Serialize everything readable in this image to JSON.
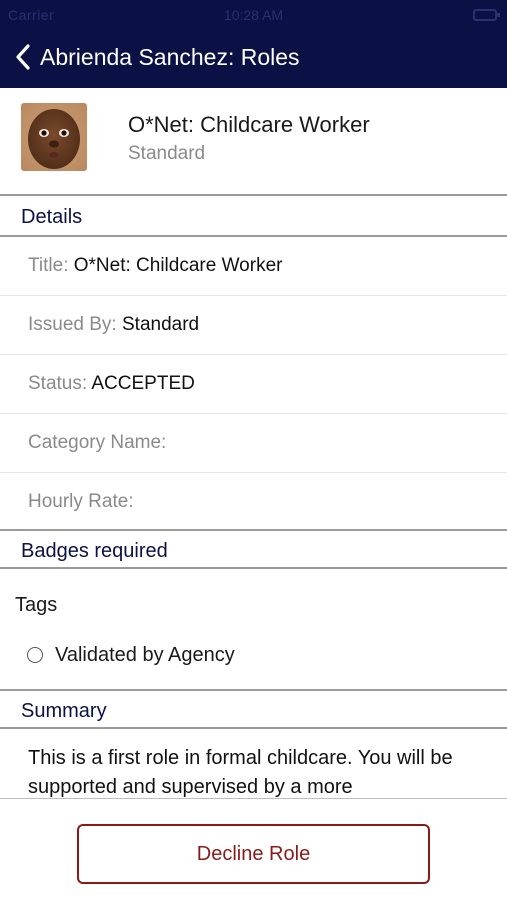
{
  "status_bar": {
    "carrier": "Carrier",
    "time": "10:28 AM"
  },
  "nav": {
    "title": "Abrienda Sanchez: Roles"
  },
  "role": {
    "title": "O*Net: Childcare Worker",
    "subtitle": "Standard"
  },
  "details": {
    "heading": "Details",
    "fields": [
      {
        "label": "Title: ",
        "value": "O*Net: Childcare Worker"
      },
      {
        "label": "Issued By: ",
        "value": "Standard"
      },
      {
        "label": "Status: ",
        "value": "ACCEPTED"
      },
      {
        "label": "Category Name:",
        "value": ""
      },
      {
        "label": "Hourly Rate:",
        "value": ""
      }
    ]
  },
  "badges": {
    "heading": "Badges required"
  },
  "tags": {
    "label": "Tags",
    "items": [
      {
        "label": "Validated by Agency",
        "checked": false
      }
    ]
  },
  "summary": {
    "heading": "Summary",
    "text": "This is a first role in formal childcare. You will be supported and supervised by a more"
  },
  "actions": {
    "decline_label": "Decline Role"
  },
  "colors": {
    "nav_bg": "#0c1145",
    "accent_text": "#0c1145",
    "decline": "#8b1a1a",
    "muted": "#8a8a8a"
  }
}
